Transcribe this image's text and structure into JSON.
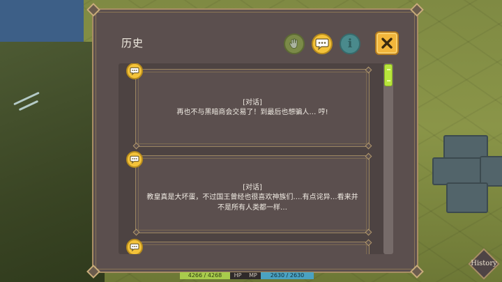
{
  "dialog": {
    "title": "历史",
    "tabs": [
      {
        "name": "hand-tab",
        "icon": "hand-icon"
      },
      {
        "name": "dialogue-tab",
        "icon": "speech-bubble-icon",
        "active": true
      },
      {
        "name": "info-tab",
        "icon": "info-icon",
        "glyph": "i"
      }
    ],
    "close_icon": "close-icon"
  },
  "history": {
    "entries": [
      {
        "kind": "[对话]",
        "text": "再也不与黑暗商会交易了！到最后也想骗人… 哼!"
      },
      {
        "kind": "[对话]",
        "text": "教皇真是大坏蛋，不过国王曾经也很喜欢神族们….有点诧异…看来并不是所有人类都一样…"
      },
      {
        "kind": "",
        "text": ""
      }
    ]
  },
  "hud": {
    "hp_value": "4266 / 4268",
    "hp_label": "HP",
    "mp_label": "MP",
    "mp_value": "2630 / 2630"
  },
  "history_button": {
    "label": "History"
  },
  "colors": {
    "panel": "#5b4f4e",
    "border": "#a88e64",
    "accent_yellow": "#f4c33a",
    "scroll_thumb": "#b8e63c"
  }
}
